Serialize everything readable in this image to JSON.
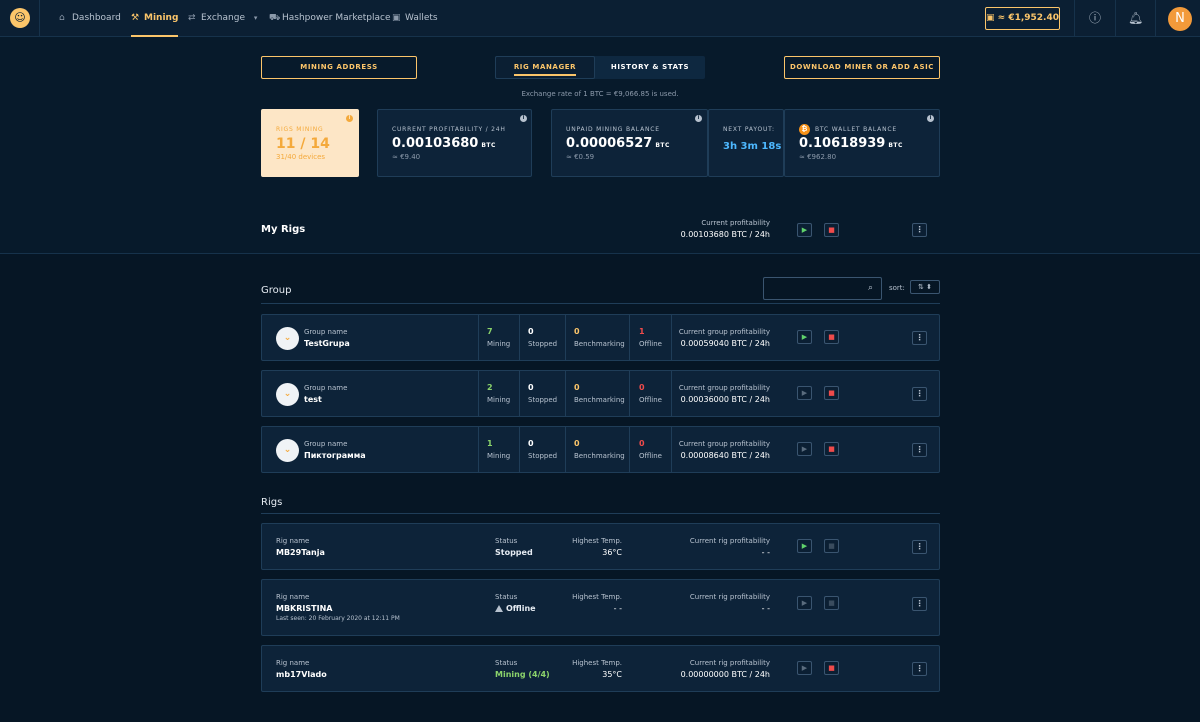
{
  "nav": {
    "logo_glyph": "☺",
    "items": [
      {
        "label": "Dashboard",
        "icon": "home-icon"
      },
      {
        "label": "Mining",
        "icon": "pickaxe-icon"
      },
      {
        "label": "Exchange",
        "icon": "exchange-icon"
      },
      {
        "label": "Hashpower Marketplace",
        "icon": "cart-icon"
      },
      {
        "label": "Wallets",
        "icon": "wallet-icon"
      }
    ],
    "balance": "≈ €1,952.40",
    "avatar_letter": "N"
  },
  "header": {
    "mining_address": "MINING ADDRESS",
    "tab_rig_manager": "RIG MANAGER",
    "tab_history": "HISTORY & STATS",
    "download": "DOWNLOAD MINER OR ADD ASIC",
    "exchange_rate": "Exchange rate of 1 BTC = €9,066.85 is used."
  },
  "stats": {
    "rigs_label": "RIGS MINING",
    "rigs_value": "11 / 14",
    "rigs_sub": "31/40 devices",
    "profit_label": "CURRENT PROFITABILITY / 24H",
    "profit_value": "0.00103680",
    "profit_unit": "BTC",
    "profit_sub": "≈ €9.40",
    "unpaid_label": "UNPAID MINING BALANCE",
    "unpaid_value": "0.00006527",
    "unpaid_unit": "BTC",
    "unpaid_sub": "≈ €0.59",
    "payout_label": "NEXT PAYOUT:",
    "payout_value": "3h 3m 18s",
    "wallet_label": "BTC WALLET BALANCE",
    "wallet_value": "0.10618939",
    "wallet_unit": "BTC",
    "wallet_sub": "≈ €962.80"
  },
  "myrigs": {
    "title": "My Rigs",
    "prof_label": "Current profitability",
    "prof_value": "0.00103680 BTC / 24h"
  },
  "group_section": {
    "title": "Group",
    "sort_label": "sort:"
  },
  "groups": [
    {
      "name_label": "Group name",
      "name": "TestGrupa",
      "mining": "7",
      "stopped": "0",
      "bench": "0",
      "offline": "1",
      "prof_label": "Current group profitability",
      "prof": "0.00059040 BTC / 24h"
    },
    {
      "name_label": "Group name",
      "name": "test",
      "mining": "2",
      "stopped": "0",
      "bench": "0",
      "offline": "0",
      "prof_label": "Current group profitability",
      "prof": "0.00036000 BTC / 24h"
    },
    {
      "name_label": "Group name",
      "name": "Пиктограмма",
      "mining": "1",
      "stopped": "0",
      "bench": "0",
      "offline": "0",
      "prof_label": "Current group profitability",
      "prof": "0.00008640 BTC / 24h"
    }
  ],
  "count_labels": {
    "mining": "Mining",
    "stopped": "Stopped",
    "bench": "Benchmarking",
    "offline": "Offline"
  },
  "rigs_section": {
    "title": "Rigs"
  },
  "rigs": [
    {
      "name_label": "Rig name",
      "name": "MB29Tanja",
      "status_label": "Status",
      "status": "Stopped",
      "temp_label": "Highest Temp.",
      "temp": "36°C",
      "prof_label": "Current rig profitability",
      "prof": "- -"
    },
    {
      "name_label": "Rig name",
      "name": "MBKRISTINA",
      "last_seen": "Last seen: 20 February 2020 at 12:11 PM",
      "status_label": "Status",
      "status": "Offline",
      "temp_label": "Highest Temp.",
      "temp": "- -",
      "prof_label": "Current rig profitability",
      "prof": "- -"
    },
    {
      "name_label": "Rig name",
      "name": "mb17Vlado",
      "status_label": "Status",
      "status": "Mining (4/4)",
      "temp_label": "Highest Temp.",
      "temp": "35°C",
      "prof_label": "Current rig profitability",
      "prof": "0.00000000 BTC / 24h"
    }
  ]
}
